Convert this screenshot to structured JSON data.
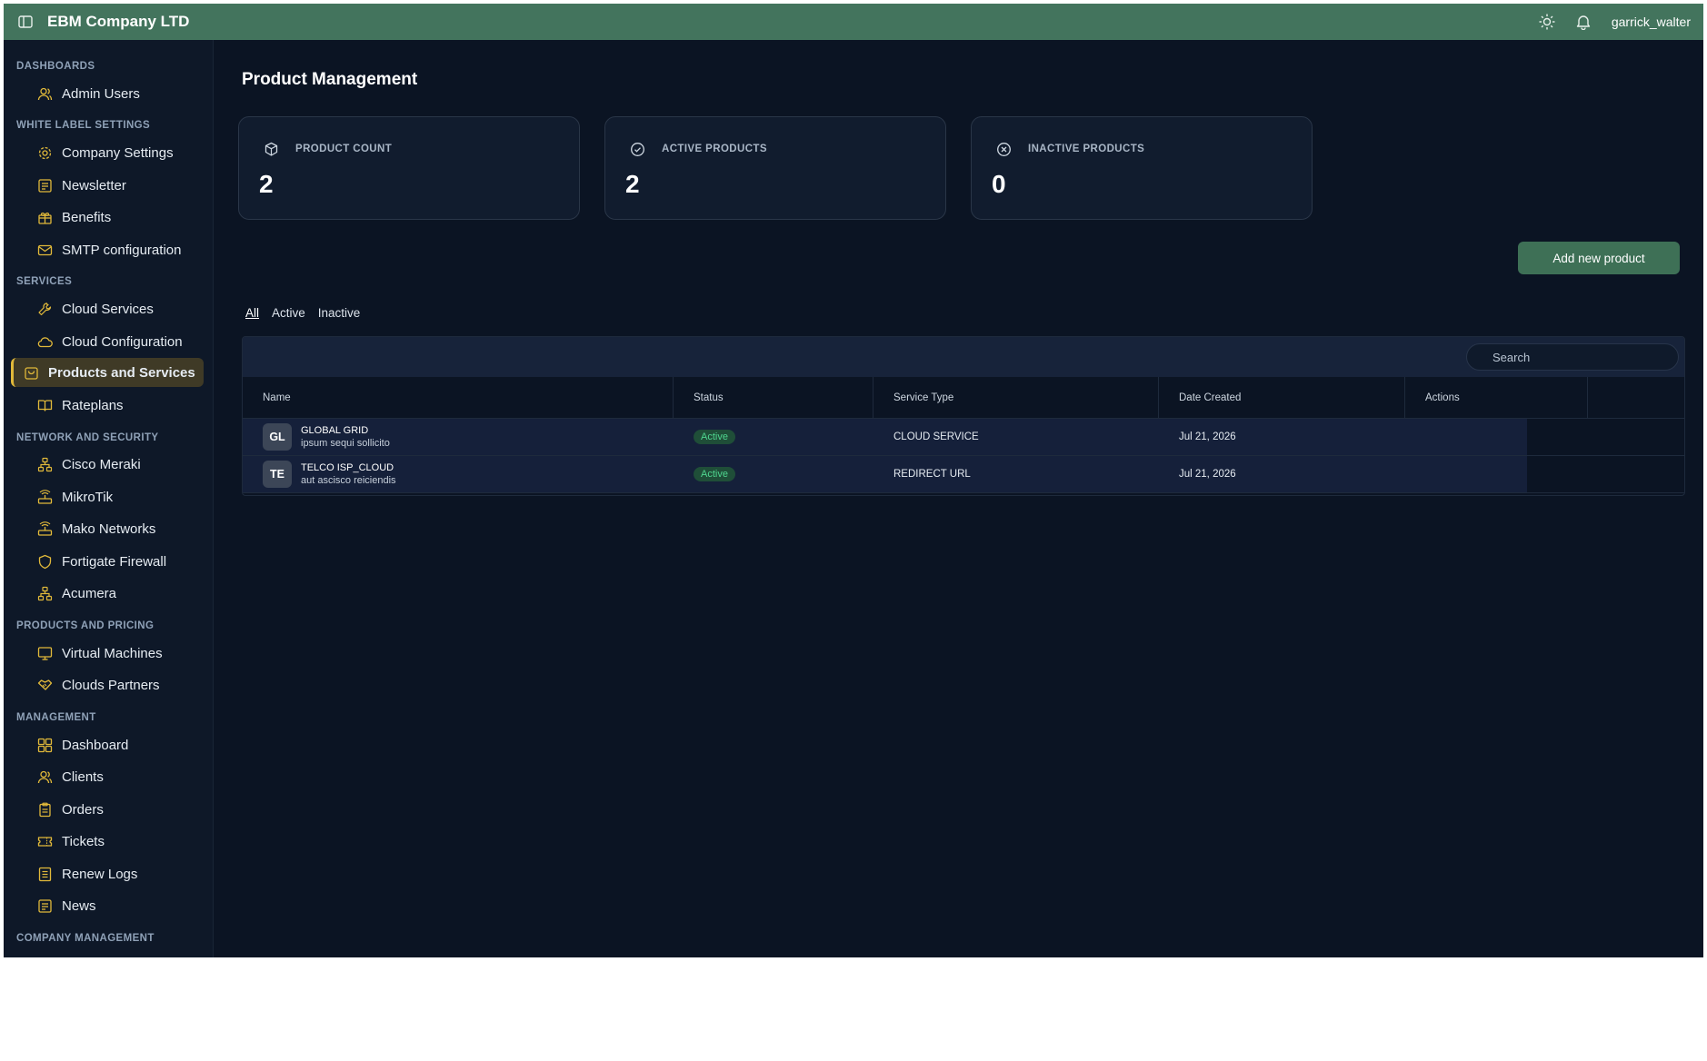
{
  "header": {
    "app_title": "EBM Company LTD",
    "username": "garrick_walter",
    "icons": [
      "sidebar-toggle-icon",
      "sun-icon",
      "bell-icon"
    ]
  },
  "sidebar": {
    "sections": [
      {
        "title": "DASHBOARDS",
        "items": [
          {
            "label": "Admin Users",
            "icon": "users-icon"
          }
        ]
      },
      {
        "title": "WHITE LABEL SETTINGS",
        "items": [
          {
            "label": "Company Settings",
            "icon": "gear-icon"
          },
          {
            "label": "Newsletter",
            "icon": "newspaper-icon"
          },
          {
            "label": "Benefits",
            "icon": "gift-icon"
          },
          {
            "label": "SMTP configuration",
            "icon": "mail-icon"
          }
        ]
      },
      {
        "title": "SERVICES",
        "items": [
          {
            "label": "Cloud Services",
            "icon": "wrench-icon"
          },
          {
            "label": "Cloud Configuration",
            "icon": "cloud-icon"
          },
          {
            "label": "Products and Services",
            "icon": "bag-icon",
            "active": true
          },
          {
            "label": "Rateplans",
            "icon": "book-icon"
          }
        ]
      },
      {
        "title": "NETWORK AND SECURITY",
        "items": [
          {
            "label": "Cisco Meraki",
            "icon": "network-icon"
          },
          {
            "label": "MikroTik",
            "icon": "router-icon"
          },
          {
            "label": "Mako Networks",
            "icon": "router-icon"
          },
          {
            "label": "Fortigate Firewall",
            "icon": "shield-icon"
          },
          {
            "label": "Acumera",
            "icon": "network-icon"
          }
        ]
      },
      {
        "title": "PRODUCTS AND PRICING",
        "items": [
          {
            "label": "Virtual Machines",
            "icon": "monitor-icon"
          },
          {
            "label": "Clouds Partners",
            "icon": "handshake-icon"
          }
        ]
      },
      {
        "title": "MANAGEMENT",
        "items": [
          {
            "label": "Dashboard",
            "icon": "grid-icon"
          },
          {
            "label": "Clients",
            "icon": "users-icon"
          },
          {
            "label": "Orders",
            "icon": "clipboard-icon"
          },
          {
            "label": "Tickets",
            "icon": "ticket-icon"
          },
          {
            "label": "Renew Logs",
            "icon": "list-icon"
          },
          {
            "label": "News",
            "icon": "newspaper-icon"
          }
        ]
      },
      {
        "title": "COMPANY MANAGEMENT",
        "items": []
      }
    ]
  },
  "main": {
    "page_title": "Product Management",
    "stats": [
      {
        "label": "PRODUCT COUNT",
        "value": "2",
        "icon": "package-icon"
      },
      {
        "label": "ACTIVE PRODUCTS",
        "value": "2",
        "icon": "check-circle-icon"
      },
      {
        "label": "INACTIVE PRODUCTS",
        "value": "0",
        "icon": "x-circle-icon"
      }
    ],
    "add_button": "Add new product",
    "tabs": [
      {
        "label": "All",
        "selected": true
      },
      {
        "label": "Active"
      },
      {
        "label": "Inactive"
      }
    ],
    "search": {
      "placeholder": "Search",
      "value": ""
    },
    "table": {
      "columns": [
        "Name",
        "Status",
        "Service Type",
        "Date Created",
        "Actions"
      ],
      "rows": [
        {
          "initials": "GL",
          "name": "GLOBAL GRID",
          "description": "ipsum sequi sollicito",
          "status": "Active",
          "service_type": "CLOUD SERVICE",
          "date_created": "Jul 21, 2026"
        },
        {
          "initials": "TE",
          "name": "TELCO ISP_CLOUD",
          "description": "aut ascisco reiciendis",
          "status": "Active",
          "service_type": "REDIRECT URL",
          "date_created": "Jul 21, 2026"
        }
      ]
    }
  },
  "colors": {
    "header_bg": "#43745d",
    "page_bg": "#0b1423",
    "active_accent": "#e1b93a",
    "status_active": "#4fd58f",
    "button_bg": "#3e7056"
  }
}
